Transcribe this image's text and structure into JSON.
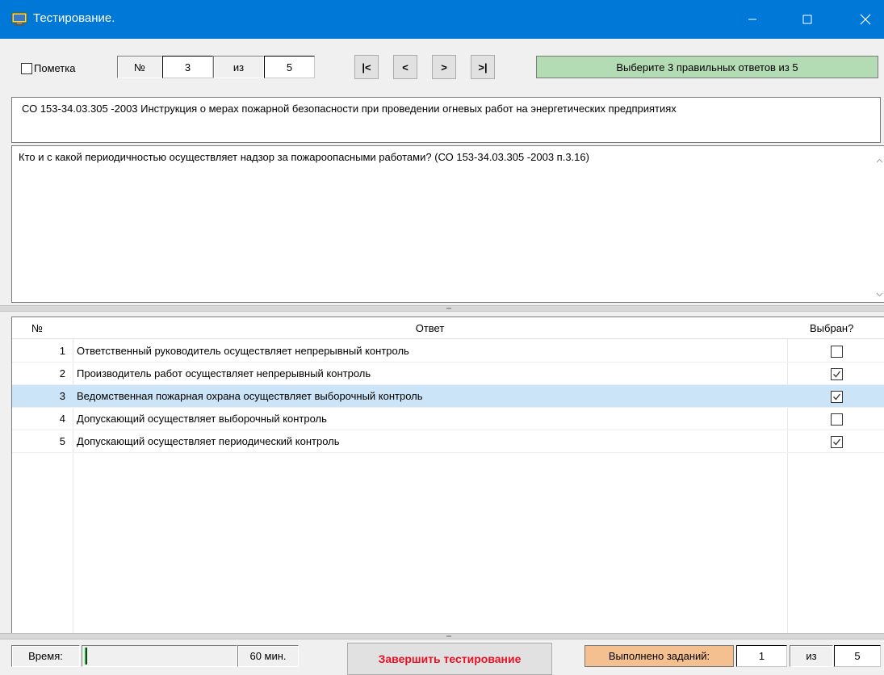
{
  "window": {
    "title": "Тестирование.",
    "app_icon": "computer-icon",
    "minimize_icon": "minimize-icon",
    "maximize_icon": "maximize-icon",
    "close_icon": "close-icon",
    "titlebar_color": "#0078d7"
  },
  "toolbar": {
    "mark_label": "Пометка",
    "mark_checked": false,
    "number_label": "№",
    "current_number": "3",
    "of_label": "из",
    "total_number": "5",
    "first_label": "|<",
    "prev_label": "<",
    "next_label": ">",
    "last_label": ">|",
    "hint": "Выберите 3 правильных ответов из 5",
    "hint_color": "#b4dcb4"
  },
  "document": {
    "title": "СО 153-34.03.305 -2003 Инструкция о мерах пожарной безопасности при проведении огневых работ на энергетических предприятиях"
  },
  "question": {
    "text": "Кто и с какой периодичностью осуществляет надзор за пожароопасными работами? (СО 153-34.03.305 -2003 п.3.16)"
  },
  "answers": {
    "columns": {
      "number": "№",
      "answer": "Ответ",
      "selected": "Выбран?"
    },
    "rows": [
      {
        "num": "1",
        "text": "Ответственный руководитель осуществляет непрерывный контроль",
        "checked": false,
        "highlighted": false
      },
      {
        "num": "2",
        "text": "Производитель работ осуществляет непрерывный контроль",
        "checked": true,
        "highlighted": false
      },
      {
        "num": "3",
        "text": "Ведомственная пожарная охрана осуществляет выборочный контроль",
        "checked": true,
        "highlighted": true
      },
      {
        "num": "4",
        "text": "Допускающий осуществляет выборочный контроль",
        "checked": false,
        "highlighted": false
      },
      {
        "num": "5",
        "text": "Допускающий осуществляет периодический контроль",
        "checked": true,
        "highlighted": false
      }
    ],
    "selected_row_color": "#cce4f7"
  },
  "status": {
    "time_label": "Время:",
    "time_progress": 0.01,
    "time_value": "60 мин.",
    "finish_label": "Завершить тестирование",
    "finish_color": "#e81123",
    "done_label": "Выполнено заданий:",
    "done_count": "1",
    "of_label": "из",
    "done_total": "5",
    "done_color": "#f5c08f"
  }
}
